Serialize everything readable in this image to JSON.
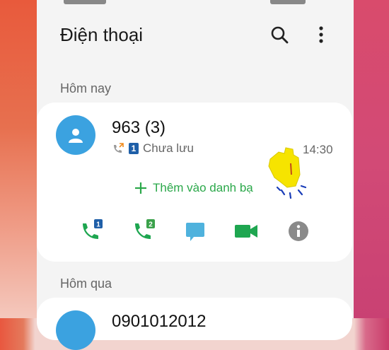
{
  "header": {
    "title": "Điện thoại",
    "icons": [
      "search-icon",
      "more-vert-icon"
    ]
  },
  "sections": {
    "today_label": "Hôm nay",
    "yesterday_label": "Hôm qua"
  },
  "call_entry": {
    "name": "963 (3)",
    "status": "Chưa lưu",
    "sim_badge": "1",
    "time": "14:30",
    "add_contact": "Thêm vào danh bạ",
    "actions": [
      {
        "icon": "call-sim1-icon",
        "badge": "1"
      },
      {
        "icon": "call-sim2-icon",
        "badge": "2"
      },
      {
        "icon": "message-icon"
      },
      {
        "icon": "video-call-icon"
      },
      {
        "icon": "info-icon"
      }
    ]
  },
  "next_entry": {
    "name_partial": "0901012012"
  },
  "colors": {
    "green": "#2ba84a",
    "blue_avatar": "#3ba2e0",
    "message": "#4fb2dd",
    "info": "#8a8a8a"
  }
}
